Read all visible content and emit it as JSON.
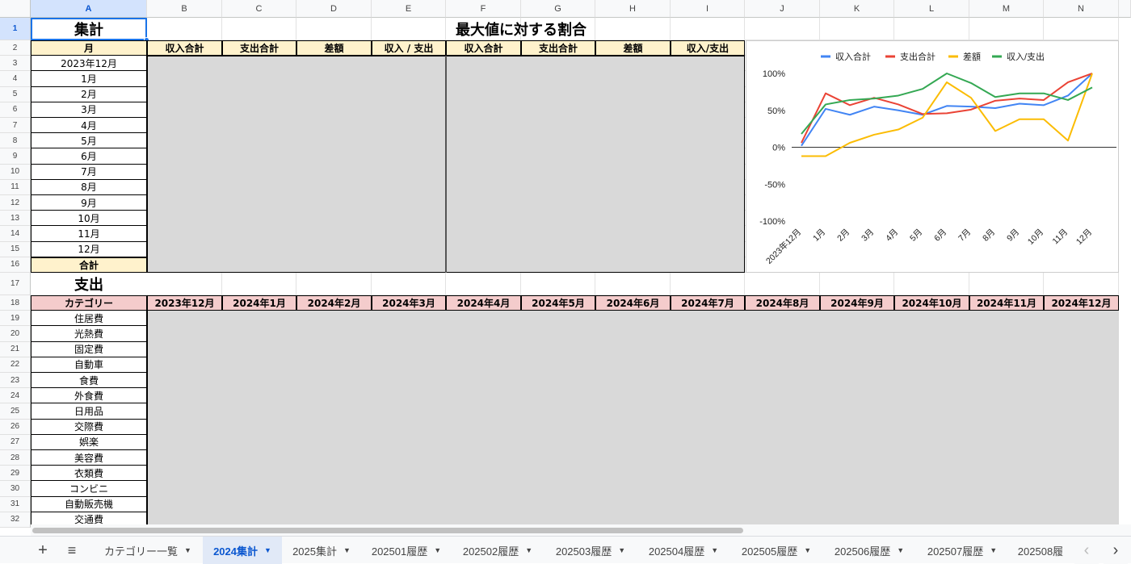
{
  "columns": [
    "A",
    "B",
    "C",
    "D",
    "E",
    "F",
    "G",
    "H",
    "I",
    "J",
    "K",
    "L",
    "M",
    "N"
  ],
  "rows": [
    1,
    2,
    3,
    4,
    5,
    6,
    7,
    8,
    9,
    10,
    11,
    12,
    13,
    14,
    15,
    16,
    17,
    18,
    19,
    20,
    21,
    22,
    23,
    24,
    25,
    26,
    27,
    28,
    29,
    30,
    31,
    32
  ],
  "summary": {
    "title": "集計",
    "month_header": "月",
    "months": [
      "2023年12月",
      "1月",
      "2月",
      "3月",
      "4月",
      "5月",
      "6月",
      "7月",
      "8月",
      "9月",
      "10月",
      "11月",
      "12月"
    ],
    "total_label": "合計",
    "headers": [
      "収入合計",
      "支出合計",
      "差額",
      "収入 / 支出"
    ]
  },
  "ratio": {
    "title": "最大値に対する割合",
    "headers": [
      "収入合計",
      "支出合計",
      "差額",
      "収入/支出"
    ]
  },
  "expense": {
    "title": "支出",
    "category_header": "カテゴリー",
    "categories": [
      "住居費",
      "光熱費",
      "固定費",
      "自動車",
      "食費",
      "外食費",
      "日用品",
      "交際費",
      "娯楽",
      "美容費",
      "衣類費",
      "コンビニ",
      "自動販売機",
      "交通費"
    ],
    "month_headers": [
      "2023年12月",
      "2024年1月",
      "2024年2月",
      "2024年3月",
      "2024年4月",
      "2024年5月",
      "2024年6月",
      "2024年7月",
      "2024年8月",
      "2024年9月",
      "2024年10月",
      "2024年11月",
      "2024年12月"
    ]
  },
  "chart_data": {
    "type": "line",
    "categories": [
      "2023年12月",
      "1月",
      "2月",
      "3月",
      "4月",
      "5月",
      "6月",
      "7月",
      "8月",
      "9月",
      "10月",
      "11月",
      "12月"
    ],
    "series": [
      {
        "name": "収入合計",
        "color": "#4285f4",
        "values": [
          2,
          52,
          44,
          55,
          50,
          44,
          56,
          55,
          53,
          59,
          57,
          70,
          100
        ]
      },
      {
        "name": "支出合計",
        "color": "#ea4335",
        "values": [
          6,
          73,
          57,
          67,
          58,
          45,
          46,
          51,
          63,
          66,
          64,
          88,
          100
        ]
      },
      {
        "name": "差額",
        "color": "#fbbc04",
        "values": [
          -12,
          -12,
          6,
          17,
          24,
          40,
          88,
          67,
          22,
          38,
          38,
          9,
          100
        ]
      },
      {
        "name": "収入/支出",
        "color": "#34a853",
        "values": [
          18,
          58,
          64,
          66,
          70,
          79,
          100,
          87,
          68,
          73,
          73,
          64,
          81
        ]
      }
    ],
    "yticks": [
      "100%",
      "50%",
      "0%",
      "-50%",
      "-100%"
    ],
    "ylim": [
      -100,
      100
    ],
    "legend_position": "top",
    "grid": false
  },
  "tabs": {
    "add_icon": "+",
    "menu_icon": "≡",
    "items": [
      {
        "label": "カテゴリー一覧",
        "active": false
      },
      {
        "label": "2024集計",
        "active": true
      },
      {
        "label": "2025集計",
        "active": false
      },
      {
        "label": "202501履歴",
        "active": false
      },
      {
        "label": "202502履歴",
        "active": false
      },
      {
        "label": "202503履歴",
        "active": false
      },
      {
        "label": "202504履歴",
        "active": false
      },
      {
        "label": "202505履歴",
        "active": false
      },
      {
        "label": "202506履歴",
        "active": false
      },
      {
        "label": "202507履歴",
        "active": false
      },
      {
        "label": "202508履",
        "active": false
      }
    ],
    "prev_icon": "‹",
    "next_icon": "›"
  }
}
